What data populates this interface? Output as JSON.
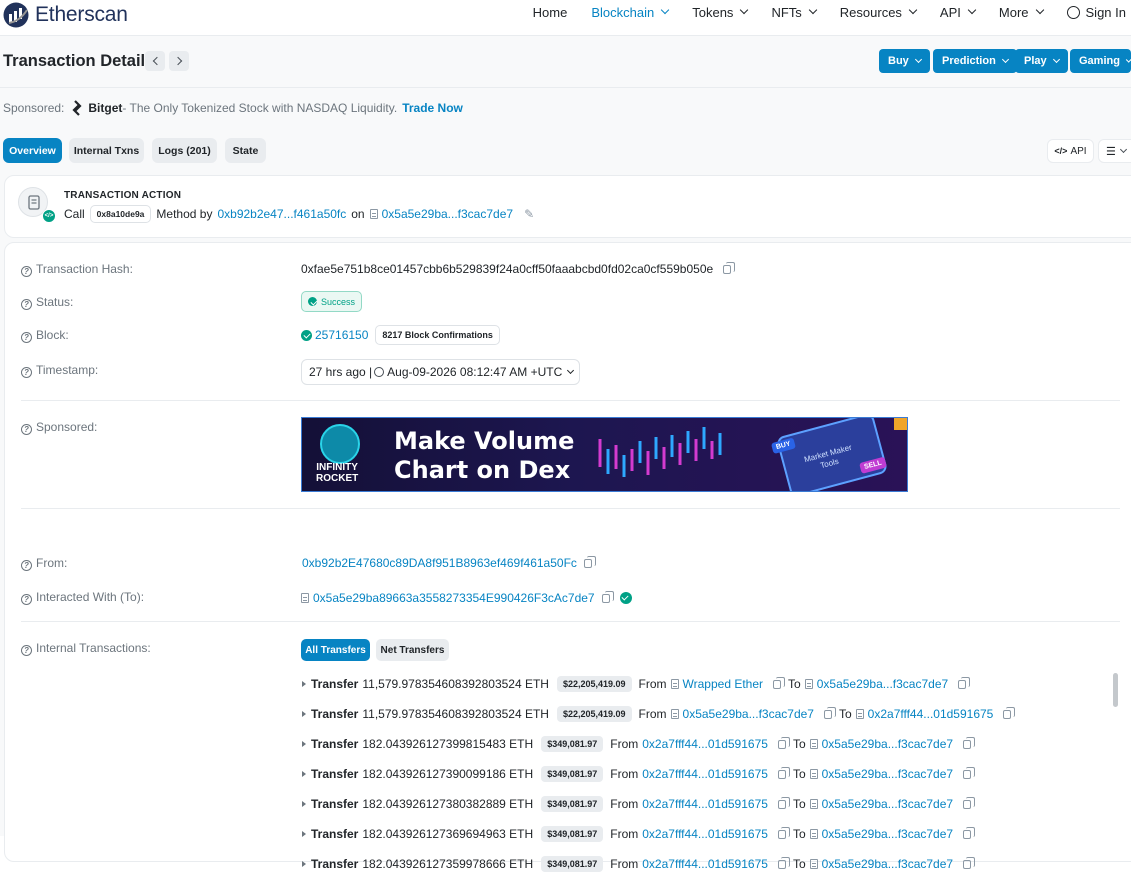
{
  "header": {
    "logo_text": "Etherscan",
    "nav": [
      {
        "label": "Home",
        "chevron": false,
        "active": false
      },
      {
        "label": "Blockchain",
        "chevron": true,
        "active": true
      },
      {
        "label": "Tokens",
        "chevron": true,
        "active": false
      },
      {
        "label": "NFTs",
        "chevron": true,
        "active": false
      },
      {
        "label": "Resources",
        "chevron": true,
        "active": false
      },
      {
        "label": "API",
        "chevron": true,
        "active": false
      },
      {
        "label": "More",
        "chevron": true,
        "active": false
      }
    ],
    "sign_in": "Sign In"
  },
  "title": "Transaction Details",
  "actions": [
    "Buy",
    "Prediction",
    "Play",
    "Gaming"
  ],
  "sponsor": {
    "prefix": "Sponsored:",
    "brand": "Bitget",
    "text": " - The Only Tokenized Stock with NASDAQ Liquidity.",
    "cta": "Trade Now"
  },
  "tabs": [
    {
      "label": "Overview",
      "active": true
    },
    {
      "label": "Internal Txns",
      "active": false
    },
    {
      "label": "Logs (201)",
      "active": false
    },
    {
      "label": "State",
      "active": false
    }
  ],
  "tools": {
    "api": "API"
  },
  "action_card": {
    "heading": "TRANSACTION ACTION",
    "call": "Call",
    "method_id": "0x8a10de9a",
    "method_by": "Method by",
    "from": "0xb92b2e47...f461a50fc",
    "on": "on",
    "to": "0x5a5e29ba...f3cac7de7"
  },
  "fields": {
    "hash_label": "Transaction Hash:",
    "hash": "0xfae5e751b8ce01457cbb6b529839f24a0cff50faaabcbd0fd02ca0cf559b050e",
    "status_label": "Status:",
    "status": "Success",
    "block_label": "Block:",
    "block": "25716150",
    "confirmations": "8217 Block Confirmations",
    "timestamp_label": "Timestamp:",
    "timestamp": "27 hrs ago | ",
    "timestamp_date": "Aug-09-2026 08:12:47 AM +UTC",
    "sponsored_label": "Sponsored:",
    "from_label": "From:",
    "from": "0xb92b2E47680c89DA8f951B8963ef469f461a50Fc",
    "to_label": "Interacted With (To):",
    "to": "0x5a5e29ba89663a3558273354E990426F3cAc7de7",
    "internal_label": "Internal Transactions:"
  },
  "ad": {
    "brand_line1": "INFINITY",
    "brand_line2": "ROCKET",
    "headline1": "Make Volume",
    "headline2": "Chart on Dex",
    "buy": "BUY",
    "sell": "SELL",
    "tag1": "Market Maker",
    "tag2": "Tools"
  },
  "transfer_tabs": [
    "All Transfers",
    "Net Transfers"
  ],
  "transfer_words": {
    "transfer": "Transfer",
    "from": "From",
    "to": "To"
  },
  "transfers": [
    {
      "amount": "11,579.978354608392803524 ETH",
      "usd": "$22,205,419.09",
      "from": "Wrapped Ether",
      "to": "0x5a5e29ba...f3cac7de7"
    },
    {
      "amount": "11,579.978354608392803524 ETH",
      "usd": "$22,205,419.09",
      "from": "0x5a5e29ba...f3cac7de7",
      "to": "0x2a7fff44...01d591675"
    },
    {
      "amount": "182.043926127399815483 ETH",
      "usd": "$349,081.97",
      "from": "0x2a7fff44...01d591675",
      "to": "0x5a5e29ba...f3cac7de7"
    },
    {
      "amount": "182.043926127390099186 ETH",
      "usd": "$349,081.97",
      "from": "0x2a7fff44...01d591675",
      "to": "0x5a5e29ba...f3cac7de7"
    },
    {
      "amount": "182.043926127380382889 ETH",
      "usd": "$349,081.97",
      "from": "0x2a7fff44...01d591675",
      "to": "0x5a5e29ba...f3cac7de7"
    },
    {
      "amount": "182.043926127369694963 ETH",
      "usd": "$349,081.97",
      "from": "0x2a7fff44...01d591675",
      "to": "0x5a5e29ba...f3cac7de7"
    },
    {
      "amount": "182.043926127359978666 ETH",
      "usd": "$349,081.97",
      "from": "0x2a7fff44...01d591675",
      "to": "0x5a5e29ba...f3cac7de7"
    }
  ],
  "colors": {
    "accent": "#0784c3",
    "success": "#00a186",
    "brand": "#21325b"
  }
}
